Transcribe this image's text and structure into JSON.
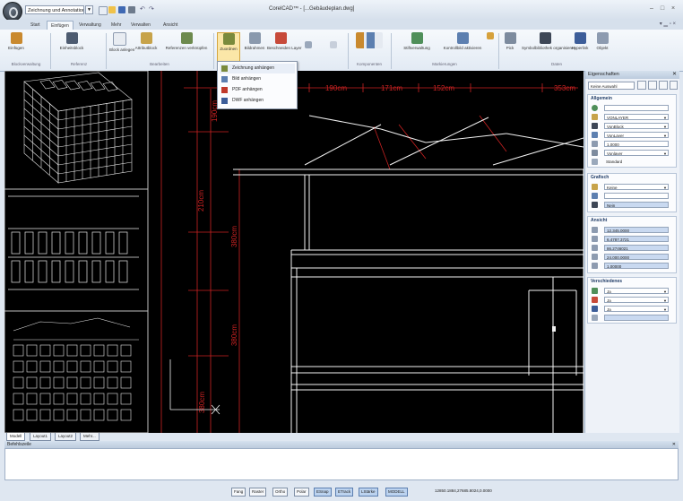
{
  "app": {
    "workspace": "Zeichnung und Annotation",
    "title": "CorelCAD™ - [...Gebäudeplan.dwg]"
  },
  "ribbon_tabs": [
    "Start",
    "Einfügen",
    "Verwaltung",
    "Mehr",
    "Verwalten",
    "Ansicht"
  ],
  "ribbon": {
    "buttons": [
      {
        "label": "Einfügen"
      },
      {
        "label": "Einheitsblock"
      },
      {
        "label": "Block anlegen"
      },
      {
        "label": "Attributblock"
      },
      {
        "label": "Referenzen verknüpfen"
      },
      {
        "label": "Zuordnen"
      },
      {
        "label": "Bildrahmen"
      },
      {
        "label": "Beschneiden Layer"
      },
      {
        "label": "Stiftverwaltung"
      },
      {
        "label": "Kontrollbild aktivieren"
      },
      {
        "label": "Pick"
      },
      {
        "label": "Symbolbibliothek organisieren"
      },
      {
        "label": "Hyperlink"
      },
      {
        "label": "Objekt"
      }
    ],
    "groups": [
      "Blockverwaltung",
      "Referenz",
      "Bearbeiten",
      "Bild",
      "Komponenten",
      "Markierungen",
      "Daten"
    ]
  },
  "attach_menu": {
    "items": [
      "Zeichnung anhängen",
      "Bild anhängen",
      "PDF anhängen",
      "DWF anhängen"
    ]
  },
  "cad": {
    "dims_h": [
      "190cm",
      "171cm",
      "152cm",
      "353cm"
    ],
    "dims_v": [
      "190cm",
      "210cm",
      "380cm",
      "380cm",
      "380cm"
    ]
  },
  "layout_tabs": [
    "Modell",
    "Layout1",
    "Layout2",
    "Mehr..."
  ],
  "panel": {
    "title": "Eigenschaften",
    "filter": "Keine Auswahl",
    "sections": [
      {
        "title": "Allgemein",
        "fields": [
          "",
          "VONLAYER",
          "VonBlock",
          "VonLayer",
          "1.0000",
          "Vonlayer",
          "Standard"
        ]
      },
      {
        "title": "Grafisch",
        "fields": [
          "Keine",
          "",
          "Nein"
        ]
      },
      {
        "title": "Ansicht",
        "fields": [
          "12.345.0000",
          "6.4787.3721",
          "86.2746021",
          "24.000.0000",
          "1.00000"
        ]
      },
      {
        "title": "Verschiedenes",
        "fields": [
          "Ja",
          "Ja",
          "Ja",
          ""
        ]
      }
    ]
  },
  "command": {
    "title": "Befehlszeile"
  },
  "status": {
    "buttons": [
      "Fang",
      "Raster",
      "Ortho",
      "Polar",
      "ESnap",
      "ETrack",
      "LStärke",
      "MODELL"
    ],
    "coords": "12850.1884,27685.8024,0.0000"
  },
  "colors": {
    "canvas": "#000000",
    "red_line": "#cc2222",
    "white_line": "#f2f2f2",
    "accent": "#bcd3ef"
  }
}
